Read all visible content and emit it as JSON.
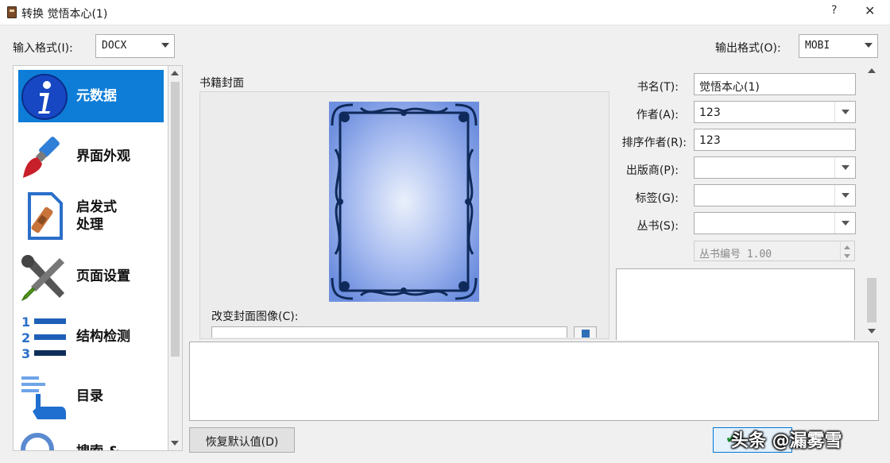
{
  "window": {
    "title": "转换 觉悟本心(1)",
    "help_icon": "?",
    "close_icon": "✕"
  },
  "input_format": {
    "label": "输入格式(I):",
    "value": "DOCX"
  },
  "output_format": {
    "label": "输出格式(O):",
    "value": "MOBI"
  },
  "sidebar": {
    "items": [
      {
        "label": "元数据",
        "icon": "info-icon",
        "active": true
      },
      {
        "label": "界面外观",
        "icon": "paintbrush-icon"
      },
      {
        "label": "启发式\n处理",
        "icon": "document-bandage-icon"
      },
      {
        "label": "页面设置",
        "icon": "tools-icon"
      },
      {
        "label": "结构检测",
        "icon": "numbered-list-icon"
      },
      {
        "label": "目录",
        "icon": "pointer-hand-icon"
      },
      {
        "label": "搜索 &",
        "icon": "search-icon"
      }
    ]
  },
  "cover": {
    "group_label": "书籍封面",
    "change_label": "改变封面图像(C):",
    "path_value": ""
  },
  "metadata": {
    "title": {
      "label": "书名(T):",
      "value": "觉悟本心(1)"
    },
    "author": {
      "label": "作者(A):",
      "value": "123"
    },
    "author_sort": {
      "label": "排序作者(R):",
      "value": "123"
    },
    "publisher": {
      "label": "出版商(P):",
      "value": ""
    },
    "tags": {
      "label": "标签(G):",
      "value": ""
    },
    "series": {
      "label": "丛书(S):",
      "value": ""
    },
    "series_index": {
      "value": "丛书编号 1.00"
    }
  },
  "buttons": {
    "restore_defaults": "恢复默认值(D)"
  },
  "watermark": "头条 @漏雾雪"
}
